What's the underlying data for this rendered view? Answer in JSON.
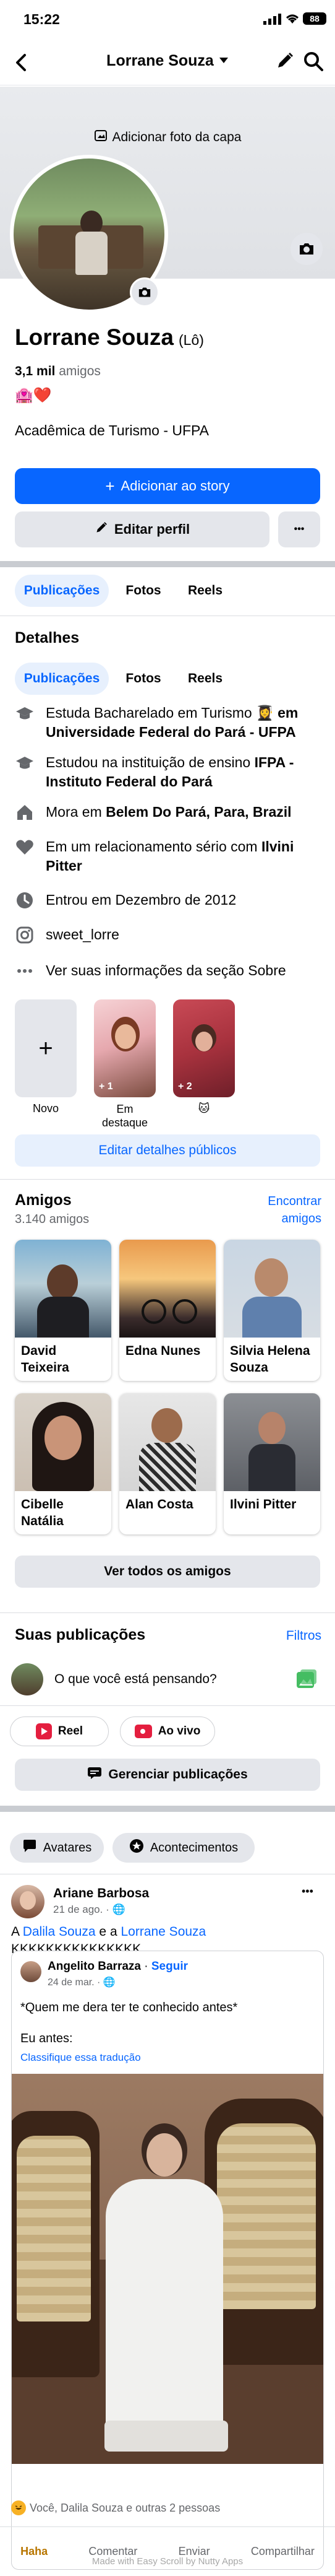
{
  "status": {
    "time": "15:22",
    "battery": "88"
  },
  "topbar": {
    "title": "Lorrane Souza"
  },
  "cover": {
    "add_photo_label": "Adicionar foto da capa"
  },
  "profile": {
    "name": "Lorrane Souza",
    "nickname": "(Lô)",
    "friends_count": "3,1 mil",
    "friends_word": "amigos",
    "emojis": "🏩❤️",
    "bio": "Acadêmica de Turismo - UFPA"
  },
  "actions": {
    "add_story": "Adicionar ao story",
    "edit_profile": "Editar perfil",
    "more": "•••"
  },
  "tabs": [
    "Publicações",
    "Fotos",
    "Reels"
  ],
  "details": {
    "heading": "Detalhes",
    "tabs": [
      "Publicações",
      "Fotos",
      "Reels"
    ],
    "items": [
      {
        "icon": "graduation-cap-icon",
        "pre": "Estuda Bacharelado em Turismo 👩‍🎓 ",
        "bold": "em Universidade Federal do Pará - UFPA"
      },
      {
        "icon": "graduation-cap-icon",
        "pre": "Estudou na instituição de ensino ",
        "bold": "IFPA - Instituto Federal do Pará"
      },
      {
        "icon": "home-icon",
        "pre": "Mora em ",
        "bold": "Belem Do Pará, Para, Brazil"
      },
      {
        "icon": "heart-icon",
        "pre": "Em um relacionamento sério com ",
        "bold": "Ilvini Pitter"
      },
      {
        "icon": "clock-icon",
        "pre": "Entrou em Dezembro de 2012",
        "bold": ""
      },
      {
        "icon": "instagram-icon",
        "pre": "sweet_lorre",
        "bold": ""
      },
      {
        "icon": "more-dots-icon",
        "pre": "Ver suas informações da seção Sobre",
        "bold": ""
      }
    ]
  },
  "highlights": {
    "items": [
      {
        "label": "Novo",
        "badge": ""
      },
      {
        "label": "Em destaque",
        "badge": "+ 1"
      },
      {
        "label": "🐱",
        "badge": "+ 2"
      }
    ],
    "edit_button": "Editar detalhes públicos"
  },
  "friends": {
    "heading": "Amigos",
    "count": "3.140 amigos",
    "find": "Encontrar amigos",
    "list": [
      {
        "name": "David Teixeira"
      },
      {
        "name": "Edna Nunes"
      },
      {
        "name": "Silvia Helena Souza"
      },
      {
        "name": "Cibelle Natália"
      },
      {
        "name": "Alan Costa"
      },
      {
        "name": "Ilvini Pitter"
      }
    ],
    "see_all": "Ver todos os amigos"
  },
  "posts": {
    "heading": "Suas publicações",
    "filters": "Filtros",
    "composer_placeholder": "O que você está pensando?",
    "reel": "Reel",
    "live": "Ao vivo",
    "manage": "Gerenciar publicações",
    "chips": [
      "Avatares",
      "Acontecimentos"
    ]
  },
  "post": {
    "author": "Ariane Barbosa",
    "meta": "21 de ago. · 🌐",
    "text_pre": "A ",
    "mention1": "Dalila Souza",
    "text_mid": " e a ",
    "mention2": "Lorrane Souza",
    "text_post": " KKKKKKKKKKKKKKK",
    "more": "•••",
    "shared": {
      "author": "Angelito Barraza",
      "follow": "Seguir",
      "meta": "24 de mar. · 🌐",
      "text": "*Quem me dera ter te conhecido antes*",
      "sub": "Eu antes:",
      "translate": "Classifique essa tradução"
    },
    "reactions": "Você, Dalila Souza e outras 2 pessoas",
    "actions": [
      "Haha",
      "Comentar",
      "Enviar",
      "Compartilhar"
    ],
    "watermark": "Made with Easy Scroll by Nutty Apps"
  }
}
